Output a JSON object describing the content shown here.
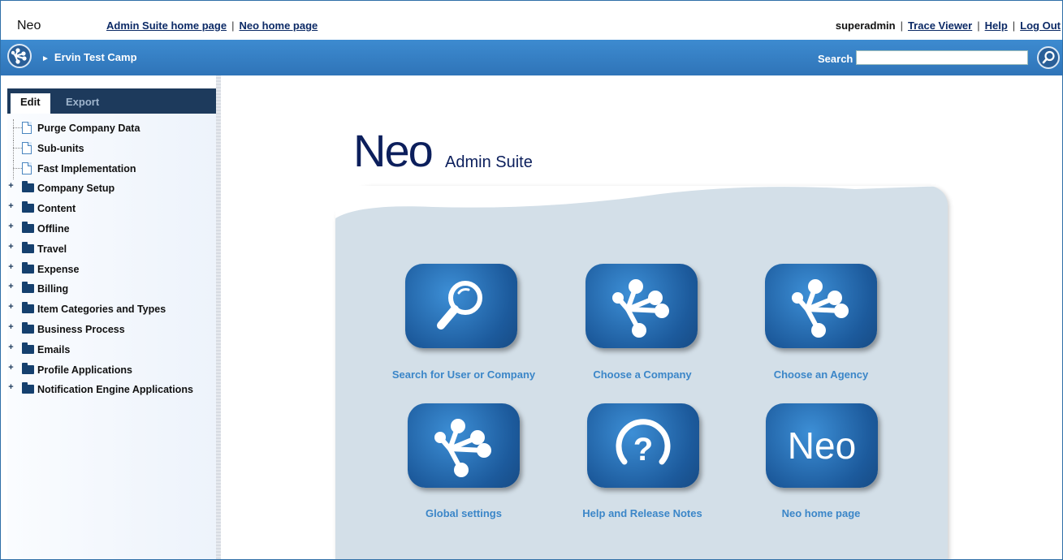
{
  "topbar": {
    "brand": "Neo",
    "links": [
      "Admin Suite home page",
      "Neo home page"
    ],
    "user": "superadmin",
    "user_links": [
      "Trace Viewer",
      "Help",
      "Log Out"
    ]
  },
  "navbar": {
    "breadcrumb": "Ervin Test Camp",
    "search_label": "Search",
    "search_value": ""
  },
  "sidebar": {
    "tabs": [
      "Edit",
      "Export"
    ],
    "leaf_items": [
      "Purge Company Data",
      "Sub-units",
      "Fast Implementation"
    ],
    "folder_items": [
      "Company Setup",
      "Content",
      "Offline",
      "Travel",
      "Expense",
      "Billing",
      "Item Categories and Types",
      "Business Process",
      "Emails",
      "Profile Applications",
      "Notification Engine Applications"
    ]
  },
  "main": {
    "logo": "Neo",
    "subtitle": "Admin Suite",
    "tiles": [
      {
        "label": "Search for User or Company",
        "icon": "search-icon"
      },
      {
        "label": "Choose a Company",
        "icon": "network-icon"
      },
      {
        "label": "Choose an Agency",
        "icon": "network-icon"
      },
      {
        "label": "Global settings",
        "icon": "network-icon"
      },
      {
        "label": "Help and Release Notes",
        "icon": "help-icon"
      },
      {
        "label": "Neo home page",
        "icon": "neo-logo-icon",
        "tile_text": "Neo"
      }
    ]
  }
}
